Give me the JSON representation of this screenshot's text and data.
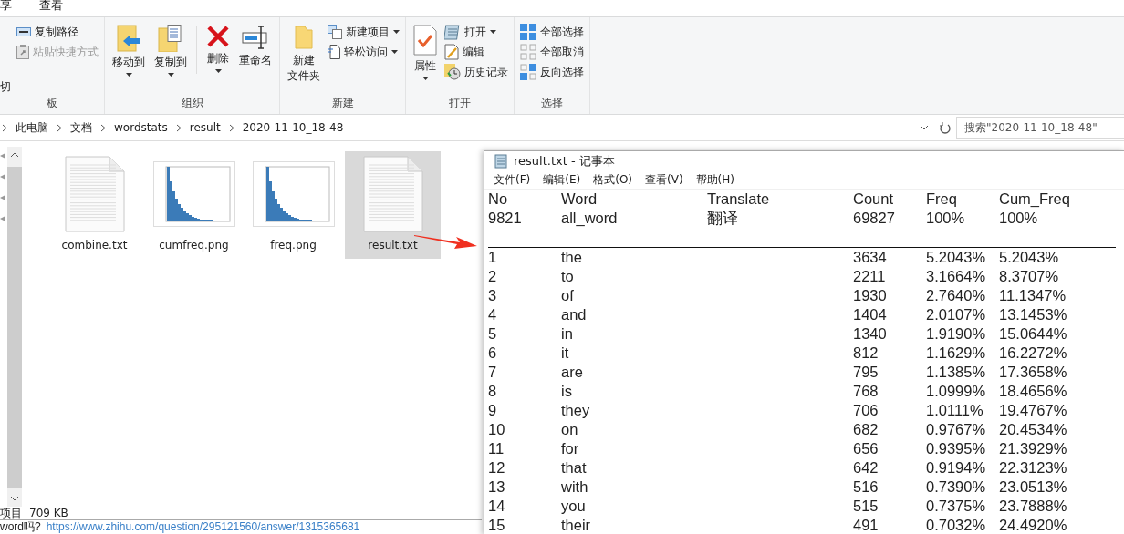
{
  "ribbon_tabs": [
    {
      "label": "享"
    },
    {
      "label": "查看"
    }
  ],
  "ribbon_groups": [
    {
      "label": "板",
      "items": [
        {
          "kind": "text",
          "label": "切"
        },
        {
          "kind": "small",
          "label": "复制路径",
          "dropdown": false,
          "disabled": false
        },
        {
          "kind": "small",
          "label": "粘贴快捷方式",
          "dropdown": false,
          "disabled": true
        }
      ]
    },
    {
      "label": "组织",
      "items": [
        {
          "kind": "large",
          "label": "移动到",
          "dropdown": true
        },
        {
          "kind": "large",
          "label": "复制到",
          "dropdown": true
        },
        {
          "kind": "separator"
        },
        {
          "kind": "large",
          "label": "删除",
          "dropdown": true
        },
        {
          "kind": "large",
          "label": "重命名",
          "dropdown": false
        }
      ]
    },
    {
      "label": "新建",
      "items": [
        {
          "kind": "large-wrap",
          "label": "新建文件夹",
          "dropdown": false
        },
        {
          "kind": "small",
          "label": "新建项目",
          "dropdown": true,
          "disabled": false
        },
        {
          "kind": "small",
          "label": "轻松访问",
          "dropdown": true,
          "disabled": false
        }
      ]
    },
    {
      "label": "打开",
      "items": [
        {
          "kind": "large",
          "label": "属性",
          "dropdown": true
        },
        {
          "kind": "small",
          "label": "打开",
          "dropdown": true,
          "disabled": false
        },
        {
          "kind": "small",
          "label": "编辑",
          "dropdown": false,
          "disabled": false
        },
        {
          "kind": "small",
          "label": "历史记录",
          "dropdown": false,
          "disabled": false
        }
      ]
    },
    {
      "label": "选择",
      "items": [
        {
          "kind": "small",
          "label": "全部选择",
          "dropdown": false,
          "disabled": false
        },
        {
          "kind": "small",
          "label": "全部取消",
          "dropdown": false,
          "disabled": false
        },
        {
          "kind": "small",
          "label": "反向选择",
          "dropdown": false,
          "disabled": false
        }
      ]
    }
  ],
  "breadcrumb": [
    "此电脑",
    "文档",
    "wordstats",
    "result",
    "2020-11-10_18-48"
  ],
  "search": {
    "placeholder": "搜索\"2020-11-10_18-48\""
  },
  "files": [
    {
      "name": "combine.txt",
      "kind": "text",
      "selected": false
    },
    {
      "name": "cumfreq.png",
      "selected": false
    },
    {
      "name": "freq.png",
      "selected": false
    },
    {
      "name": "result.txt",
      "kind": "text",
      "selected": true
    }
  ],
  "status_bar": [
    "项目",
    "709 KB"
  ],
  "background_text": {
    "text": "word吗?",
    "link": "https://www.zhihu.com/question/295121560/answer/1315365681"
  },
  "notepad": {
    "title": "result.txt - 记事本",
    "menu": [
      "文件(F)",
      "编辑(E)",
      "格式(O)",
      "查看(V)",
      "帮助(H)"
    ],
    "header": [
      "No",
      "Word",
      "Translate",
      "Count",
      "Freq",
      "Cum_Freq"
    ],
    "total": [
      "9821",
      "all_word",
      "翻译",
      "69827",
      "100%",
      "100%"
    ],
    "rows": [
      [
        "1",
        "the",
        "3634",
        "5.2043%",
        "5.2043%"
      ],
      [
        "2",
        "to",
        "2211",
        "3.1664%",
        "8.3707%"
      ],
      [
        "3",
        "of",
        "1930",
        "2.7640%",
        "11.1347%"
      ],
      [
        "4",
        "and",
        "1404",
        "2.0107%",
        "13.1453%"
      ],
      [
        "5",
        "in",
        "1340",
        "1.9190%",
        "15.0644%"
      ],
      [
        "6",
        "it",
        "812",
        "1.1629%",
        "16.2272%"
      ],
      [
        "7",
        "are",
        "795",
        "1.1385%",
        "17.3658%"
      ],
      [
        "8",
        "is",
        "768",
        "1.0999%",
        "18.4656%"
      ],
      [
        "9",
        "they",
        "706",
        "1.0111%",
        "19.4767%"
      ],
      [
        "10",
        "on",
        "682",
        "0.9767%",
        "20.4534%"
      ],
      [
        "11",
        "for",
        "656",
        "0.9395%",
        "21.3929%"
      ],
      [
        "12",
        "that",
        "642",
        "0.9194%",
        "22.3123%"
      ],
      [
        "13",
        "with",
        "516",
        "0.7390%",
        "23.0513%"
      ],
      [
        "14",
        "you",
        "515",
        "0.7375%",
        "23.7888%"
      ],
      [
        "15",
        "their",
        "491",
        "0.7032%",
        "24.4920%"
      ]
    ]
  }
}
